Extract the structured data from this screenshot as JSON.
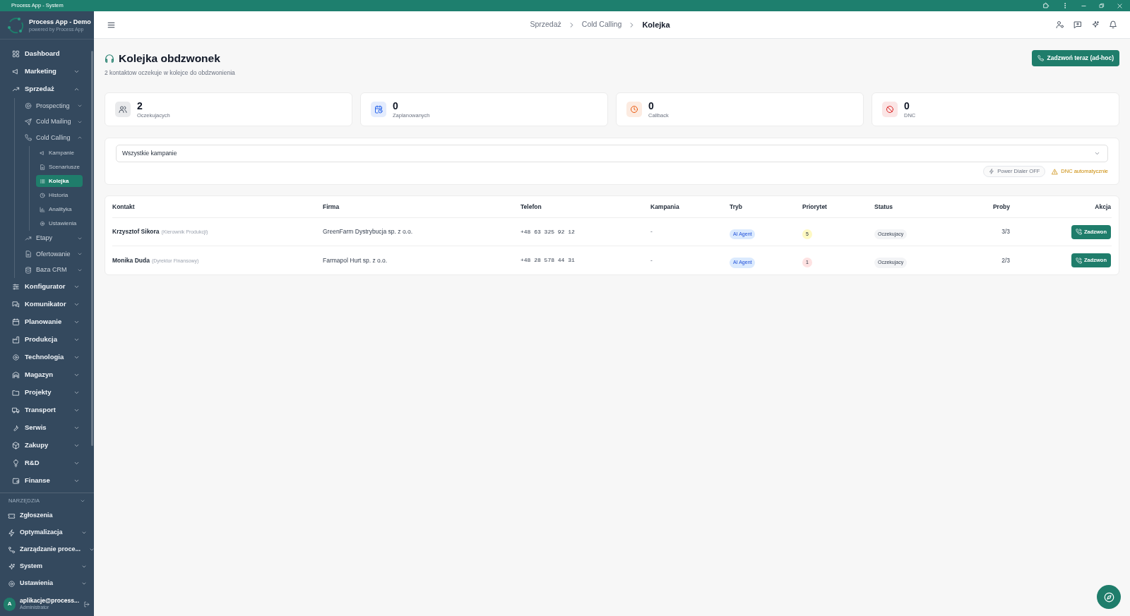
{
  "window": {
    "title": "Process App - System"
  },
  "app": {
    "name": "Process App - Demo",
    "tagline": "powered by Process App"
  },
  "sidebar": {
    "items": [
      {
        "label": "Dashboard",
        "kind": "link",
        "selected": false
      },
      {
        "label": "Marketing",
        "kind": "group",
        "expanded": false,
        "selected": false
      },
      {
        "label": "Sprzedaż",
        "kind": "group",
        "expanded": true,
        "selected": false,
        "children": [
          {
            "label": "Prospecting",
            "kind": "group",
            "expanded": false,
            "selected": false
          },
          {
            "label": "Cold Mailing",
            "kind": "group",
            "expanded": false,
            "selected": false
          },
          {
            "label": "Cold Calling",
            "kind": "group",
            "expanded": true,
            "selected": false,
            "children": [
              {
                "label": "Kampanie",
                "selected": false
              },
              {
                "label": "Scenariusze",
                "selected": false
              },
              {
                "label": "Kolejka",
                "selected": true
              },
              {
                "label": "Historia",
                "selected": false
              },
              {
                "label": "Analityka",
                "selected": false
              },
              {
                "label": "Ustawienia",
                "selected": false
              }
            ]
          },
          {
            "label": "Etapy",
            "kind": "group",
            "expanded": false,
            "selected": false
          },
          {
            "label": "Ofertowanie",
            "kind": "group",
            "expanded": false,
            "selected": false
          },
          {
            "label": "Baza CRM",
            "kind": "group",
            "expanded": false,
            "selected": false
          }
        ]
      },
      {
        "label": "Konfigurator",
        "kind": "group",
        "expanded": false,
        "selected": false
      },
      {
        "label": "Komunikator",
        "kind": "group",
        "expanded": false,
        "selected": false
      },
      {
        "label": "Planowanie",
        "kind": "group",
        "expanded": false,
        "selected": false
      },
      {
        "label": "Produkcja",
        "kind": "group",
        "expanded": false,
        "selected": false
      },
      {
        "label": "Technologia",
        "kind": "group",
        "expanded": false,
        "selected": false
      },
      {
        "label": "Magazyn",
        "kind": "group",
        "expanded": false,
        "selected": false
      },
      {
        "label": "Projekty",
        "kind": "group",
        "expanded": false,
        "selected": false
      },
      {
        "label": "Transport",
        "kind": "group",
        "expanded": false,
        "selected": false
      },
      {
        "label": "Serwis",
        "kind": "group",
        "expanded": false,
        "selected": false
      },
      {
        "label": "Zakupy",
        "kind": "group",
        "expanded": false,
        "selected": false
      },
      {
        "label": "R&D",
        "kind": "group",
        "expanded": false,
        "selected": false
      },
      {
        "label": "Finanse",
        "kind": "group",
        "expanded": false,
        "selected": false
      }
    ],
    "tools": {
      "heading": "NARZĘDZIA",
      "expanded": false,
      "items": [
        {
          "label": "Zgłoszenia",
          "kind": "link",
          "selected": false
        },
        {
          "label": "Optymalizacja",
          "kind": "group",
          "expanded": false,
          "selected": false
        },
        {
          "label": "Zarządzanie proce...",
          "kind": "group",
          "expanded": false,
          "selected": false
        },
        {
          "label": "System",
          "kind": "group",
          "expanded": false,
          "selected": false
        },
        {
          "label": "Ustawienia",
          "kind": "group",
          "expanded": false,
          "selected": false
        }
      ]
    }
  },
  "user": {
    "initial": "A",
    "email": "aplikacje@process...",
    "role": "Administrator"
  },
  "breadcrumb": [
    {
      "label": "Sprzedaż",
      "current": false
    },
    {
      "label": "Cold Calling",
      "current": false
    },
    {
      "label": "Kolejka",
      "current": true
    }
  ],
  "page": {
    "title": "Kolejka obdzwonek",
    "subtitle": "2 kontaktow oczekuje w kolejce do obdzwonienia",
    "action_button": "Zadzwoń teraz (ad-hoc)"
  },
  "stats": [
    {
      "value": "2",
      "label": "Oczekujacych",
      "color": "#4b5563"
    },
    {
      "value": "0",
      "label": "Zaplanowanych",
      "color": "#2563eb"
    },
    {
      "value": "0",
      "label": "Callback",
      "color": "#ea580c"
    },
    {
      "value": "0",
      "label": "DNC",
      "color": "#dc2626"
    }
  ],
  "filter": {
    "value": "Wszystkie kampanie"
  },
  "indicators": [
    {
      "kind": "pill",
      "label": "Power Dialer OFF"
    },
    {
      "kind": "warning",
      "label": "DNC automatycznie"
    }
  ],
  "table": {
    "columns": [
      "Kontakt",
      "Firma",
      "Telefon",
      "Kampania",
      "Tryb",
      "Priorytet",
      "Status",
      "Proby",
      "Akcja"
    ],
    "rows": [
      {
        "contact": "Krzysztof Sikora",
        "role": "(Kierownik Produkcji)",
        "company": "GreenFarm Dystrybucja sp. z o.o.",
        "phone": "+48 63 325 92 12",
        "campaign": "-",
        "mode": "AI Agent",
        "priority": "5",
        "color": "#fef9c3",
        "status": "Oczekujacy",
        "attempts": "3/3",
        "action": "Zadzwon"
      },
      {
        "contact": "Monika Duda",
        "role": "(Dyrektor Finansowy)",
        "company": "Farmapol Hurt sp. z o.o.",
        "phone": "+48 28 578 44 31",
        "campaign": "-",
        "mode": "AI Agent",
        "priority": "1",
        "color": "#fee2e2",
        "status": "Oczekujacy",
        "attempts": "2/3",
        "action": "Zadzwon"
      }
    ]
  }
}
